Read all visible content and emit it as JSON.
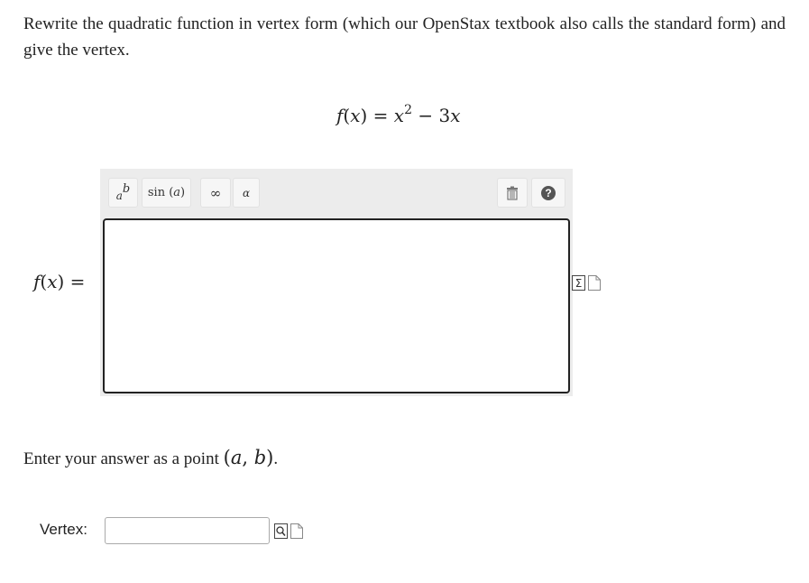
{
  "question": {
    "prompt": "Rewrite the quadratic function in vertex form (which our OpenStax textbook also calls the standard form) and give the vertex.",
    "function": {
      "lhs": "f",
      "var": "x",
      "expr_var": "x",
      "exponent": "2",
      "minus": " − ",
      "linear_coef": "3",
      "linear_var": "x"
    }
  },
  "editor": {
    "toolbar": {
      "power": {
        "base": "a",
        "exp": "b"
      },
      "sin_label": "sin",
      "sin_arg": "a",
      "infinity": "∞",
      "alpha": "α"
    },
    "answer_label_lhs": "f",
    "answer_label_var": "x",
    "answer_value": ""
  },
  "instruction": {
    "text": "Enter your answer as a point ",
    "point_a": "a",
    "point_b": "b"
  },
  "vertex": {
    "label": "Vertex:",
    "value": ""
  }
}
